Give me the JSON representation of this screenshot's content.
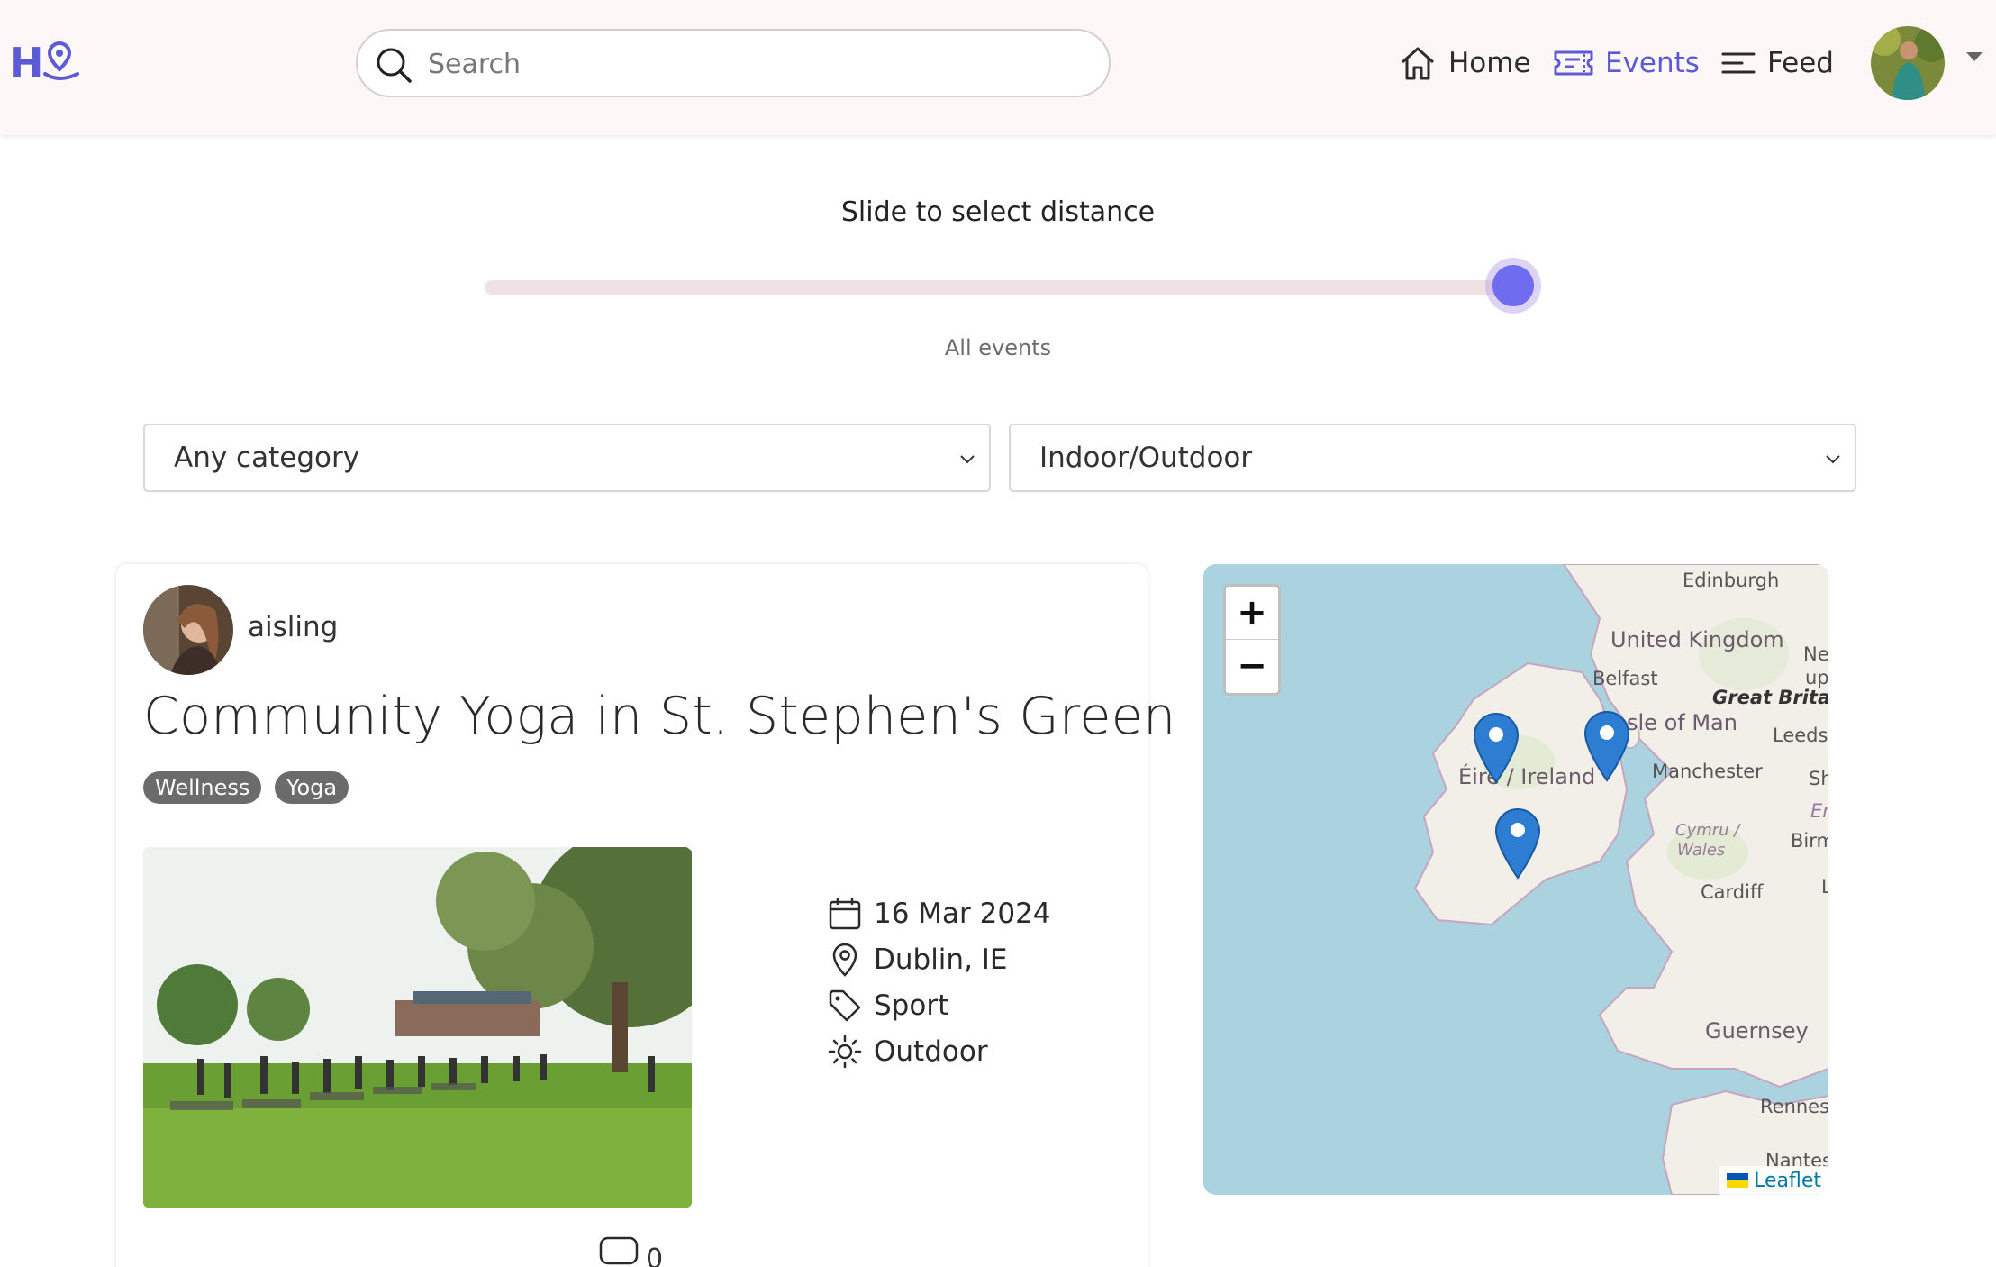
{
  "header": {
    "logo_text": "H",
    "search_placeholder": "Search",
    "nav": [
      {
        "label": "Home",
        "icon": "home-icon"
      },
      {
        "label": "Events",
        "icon": "ticket-icon",
        "active": true
      },
      {
        "label": "Feed",
        "icon": "feed-icon"
      }
    ],
    "active_color": "#5b5bd6"
  },
  "distance": {
    "label": "Slide to select distance",
    "value_text": "All events",
    "level": 1.0,
    "thumb_color": "#6f6cf0"
  },
  "filters": {
    "category": "Any category",
    "setting": "Indoor/Outdoor"
  },
  "event": {
    "username": "aisling",
    "title": "Community Yoga in St. Stephen's Green",
    "tags": [
      "Wellness",
      "Yoga"
    ],
    "date": "16 Mar 2024",
    "location": "Dublin, IE",
    "category": "Sport",
    "setting": "Outdoor",
    "comment_count": "0"
  },
  "map": {
    "zoom_in": "+",
    "zoom_out": "−",
    "attribution": "Leaflet",
    "labels": {
      "edinburgh": "Edinburgh",
      "united_kingdom": "United Kingdom",
      "belfast": "Belfast",
      "great_britain": "Great Britain",
      "isle_of_man": "sle of Man",
      "leeds": "Leeds",
      "manchester": "Manchester",
      "eire_ireland": "Éire / Ireland",
      "cymru": "Cymru /",
      "wales": "Wales",
      "cardiff": "Cardiff",
      "birm": "Birm",
      "guernsey": "Guernsey",
      "rennes": "Rennes",
      "nantes": "Nantes",
      "ne": "Ne",
      "up": "up",
      "sh": "Sh",
      "en": "En",
      "l": "L"
    }
  }
}
